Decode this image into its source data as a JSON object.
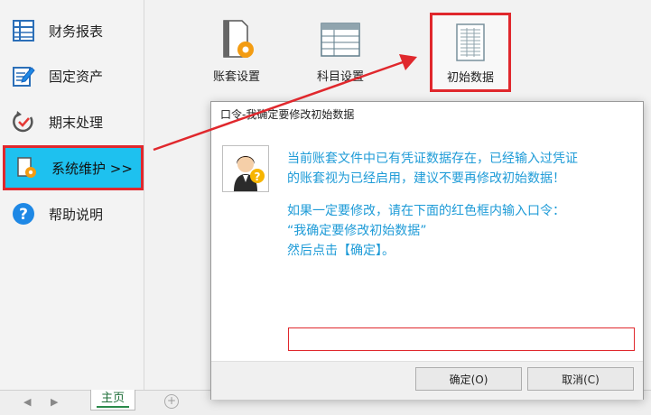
{
  "sidebar": {
    "items": [
      {
        "label": "财务报表",
        "icon": "spreadsheet-icon"
      },
      {
        "label": "固定资产",
        "icon": "edit-document-icon"
      },
      {
        "label": "期末处理",
        "icon": "check-cycle-icon"
      },
      {
        "label": "系统维护 >>",
        "icon": "gear-document-icon"
      },
      {
        "label": "帮助说明",
        "icon": "help-icon"
      }
    ]
  },
  "tiles": [
    {
      "label": "账套设置",
      "icon": "gear-document-icon"
    },
    {
      "label": "科目设置",
      "icon": "table-icon"
    },
    {
      "label": "初始数据",
      "icon": "data-sheet-icon"
    }
  ],
  "bottom": {
    "sheet_tab": "主页",
    "prev_arrow": "◀",
    "next_arrow": "▶",
    "add_symbol": "+"
  },
  "dialog": {
    "title": "口令-我确定要修改初始数据",
    "message_line1": "当前账套文件中已有凭证数据存在，已经输入过凭证",
    "message_line2": "的账套视为已经启用，建议不要再修改初始数据！",
    "message_line3": "如果一定要修改，请在下面的红色框内输入口令：",
    "message_line4": "“我确定要修改初始数据”",
    "message_line5": "然后点击【确定】。",
    "input_value": "",
    "ok_label": "确定(O)",
    "cancel_label": "取消(C)"
  },
  "colors": {
    "accent": "#1ec1ef",
    "highlight_border": "#e0282d",
    "message_text": "#1e9bd7"
  }
}
